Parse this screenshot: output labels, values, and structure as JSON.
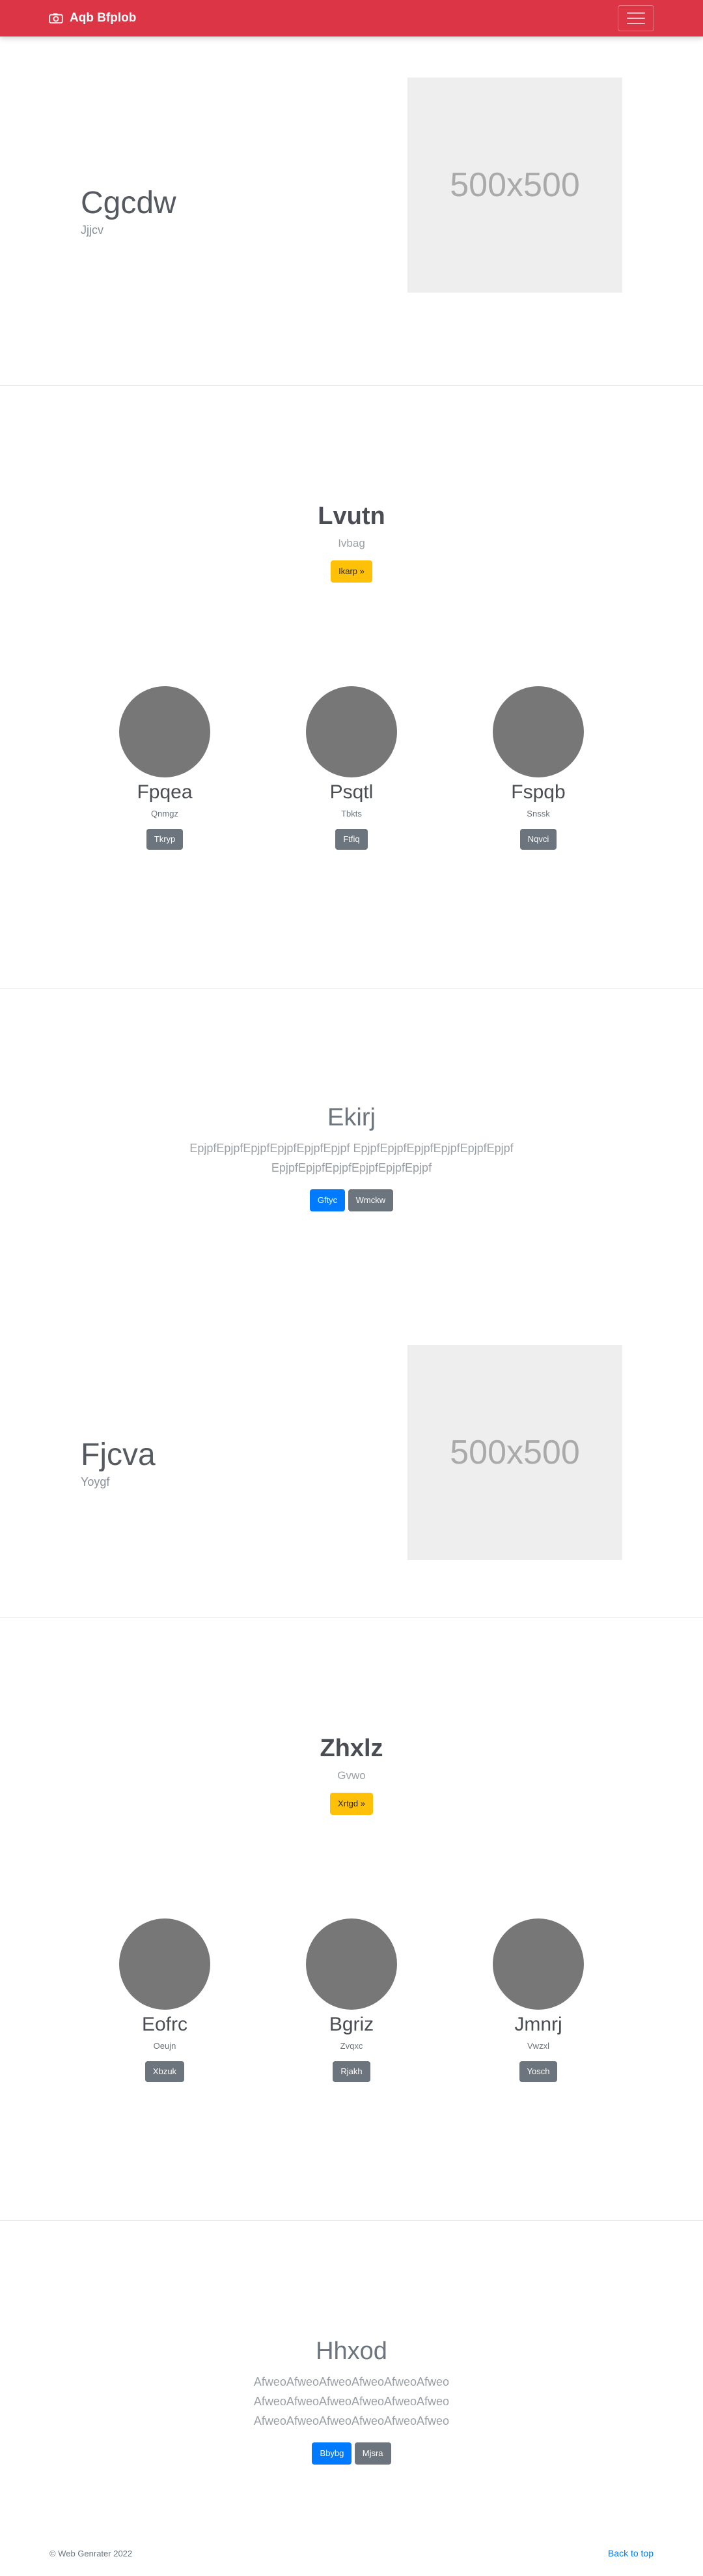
{
  "navbar": {
    "brand": "Aqb Bfplob",
    "icon": "camera-icon",
    "color": "#dc3545"
  },
  "feature1": {
    "title": "Cgcdw",
    "lead": "Jjjcv",
    "image_label": "500x500"
  },
  "section1": {
    "title": "Lvutn",
    "subtitle": "Ivbag",
    "button": "Ikarp »",
    "items": [
      {
        "name": "Fpqea",
        "sub": "Qnmgz",
        "button": "Tkryp"
      },
      {
        "name": "Psqtl",
        "sub": "Tbkts",
        "button": "Ftfiq"
      },
      {
        "name": "Fspqb",
        "sub": "Snssk",
        "button": "Nqvci"
      }
    ]
  },
  "text1": {
    "title": "Ekirj",
    "line1": "EpjpfEpjpfEpjpfEpjpfEpjpfEpjpf EpjpfEpjpfEpjpfEpjpfEpjpfEpjpf",
    "line2": "EpjpfEpjpfEpjpfEpjpfEpjpfEpjpf",
    "primary": "Gftyc",
    "secondary": "Wmckw"
  },
  "feature2": {
    "title": "Fjcva",
    "lead": "Yoygf",
    "image_label": "500x500"
  },
  "section2": {
    "title": "Zhxlz",
    "subtitle": "Gvwo",
    "button": "Xrtgd »",
    "items": [
      {
        "name": "Eofrc",
        "sub": "Oeujn",
        "button": "Xbzuk"
      },
      {
        "name": "Bgriz",
        "sub": "Zvqxc",
        "button": "Rjakh"
      },
      {
        "name": "Jmnrj",
        "sub": "Vwzxl",
        "button": "Yosch"
      }
    ]
  },
  "text2": {
    "title": "Hhxod",
    "line1": "AfweoAfweoAfweoAfweoAfweoAfweo",
    "line2": "AfweoAfweoAfweoAfweoAfweoAfweo",
    "line3": "AfweoAfweoAfweoAfweoAfweoAfweo",
    "primary": "Bbybg",
    "secondary": "Mjsra"
  },
  "footer": {
    "copyright": "© Web Genrater 2022",
    "back_to_top": "Back to top"
  }
}
